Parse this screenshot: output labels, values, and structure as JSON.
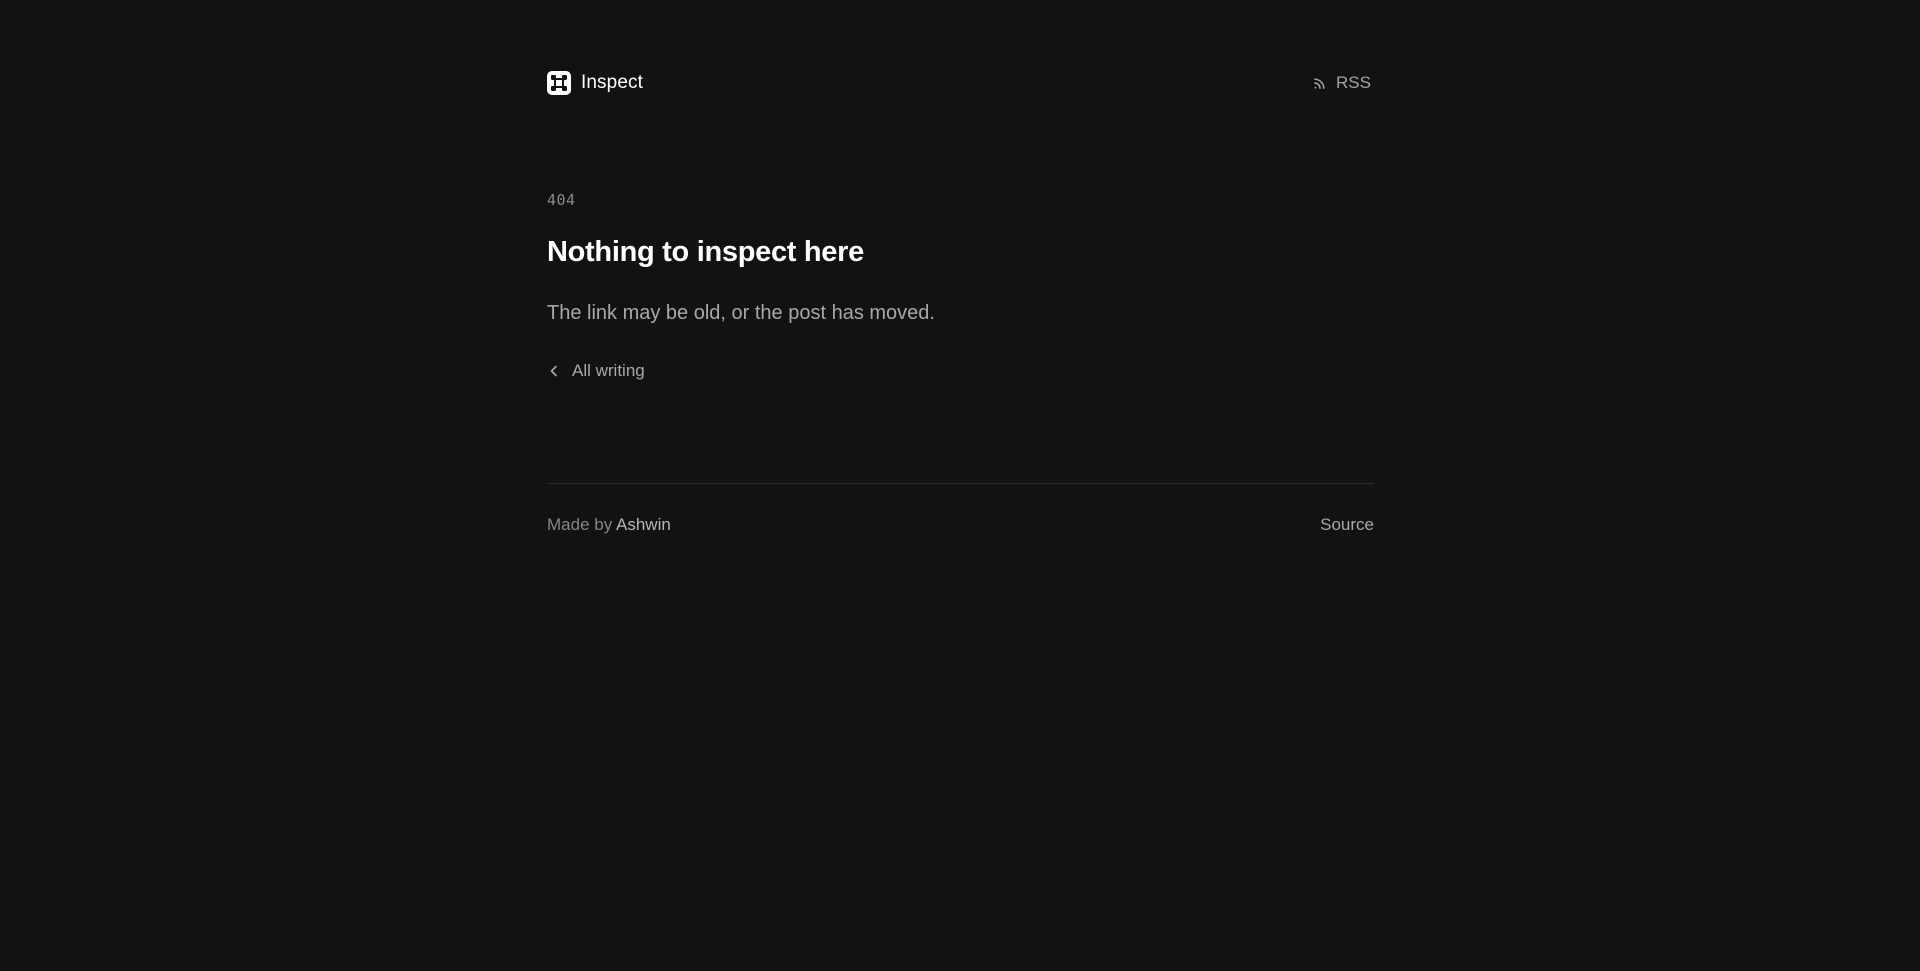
{
  "header": {
    "brand_name": "Inspect",
    "rss_label": "RSS"
  },
  "main": {
    "error_code": "404",
    "title": "Nothing to inspect here",
    "description": "The link may be old, or the post has moved.",
    "back_label": "All writing"
  },
  "footer": {
    "made_by_prefix": "Made by",
    "author": "Ashwin",
    "source_label": "Source"
  },
  "icons": {
    "brand": "inspect-logo-icon",
    "rss": "rss-icon",
    "back": "chevron-left-icon"
  },
  "colors": {
    "background": "#121212",
    "text_primary": "#ffffff",
    "text_secondary": "#a8a8a8",
    "text_muted": "#858585",
    "divider": "#2c2c2c"
  }
}
